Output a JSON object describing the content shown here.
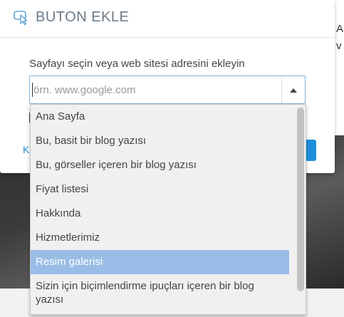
{
  "modal": {
    "title": "BUTON EKLE",
    "field_label": "Sayfayı seçin veya web sitesi adresini ekleyin",
    "url_input": {
      "value": "",
      "placeholder": "örn. www.google.com"
    },
    "left_button_fragment": "K"
  },
  "background": {
    "right_text": [
      "A",
      "v"
    ]
  },
  "dropdown": {
    "items": [
      "Ana Sayfa",
      "Bu, basit bir blog yazısı",
      "Bu, görseller içeren bir blog yazısı",
      "Fiyat listesi",
      "Hakkında",
      "Hizmetlerimiz",
      "Resim galerisi",
      "Sizin için biçimlendirme ipuçları içeren bir blog yazısı"
    ],
    "selected_index": 6
  },
  "colors": {
    "accent": "#1e8fdc",
    "selected_item": "#99bde6",
    "title_text": "#6b7a86"
  },
  "icons": {
    "header": "cursor-click-icon",
    "dropdown_toggle": "caret-up-icon"
  }
}
